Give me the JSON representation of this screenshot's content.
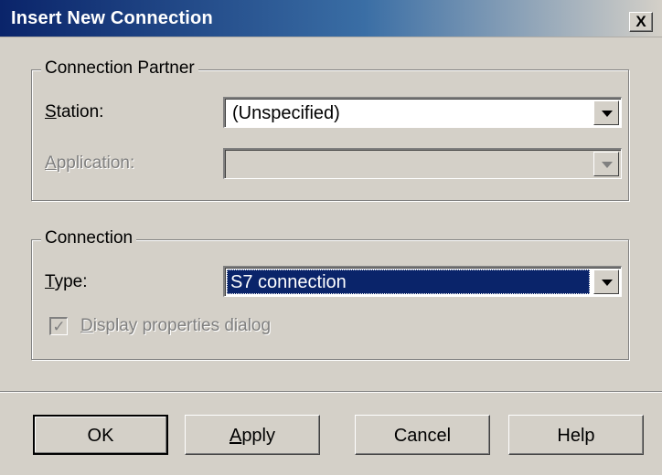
{
  "window": {
    "title": "Insert New Connection",
    "close_label": "X"
  },
  "partner_group": {
    "title": "Connection Partner",
    "station": {
      "label_mnemonic": "S",
      "label_rest": "tation:",
      "value": "(Unspecified)"
    },
    "application": {
      "label_mnemonic": "A",
      "label_rest": "pplication:",
      "value": "",
      "disabled": true
    }
  },
  "connection_group": {
    "title": "Connection",
    "type": {
      "label_mnemonic": "T",
      "label_rest": "ype:",
      "value": "S7 connection"
    },
    "display_properties": {
      "label_mnemonic": "D",
      "label_rest": "isplay properties dialog",
      "checked": true,
      "disabled": true
    }
  },
  "buttons": {
    "ok": "OK",
    "apply_mnemonic": "A",
    "apply_rest": "pply",
    "cancel": "Cancel",
    "help": "Help"
  },
  "colors": {
    "titlebar_start": "#0a246a",
    "titlebar_end": "#d4d0c8",
    "dialog_bg": "#d4d0c8",
    "selection": "#0a246a"
  }
}
